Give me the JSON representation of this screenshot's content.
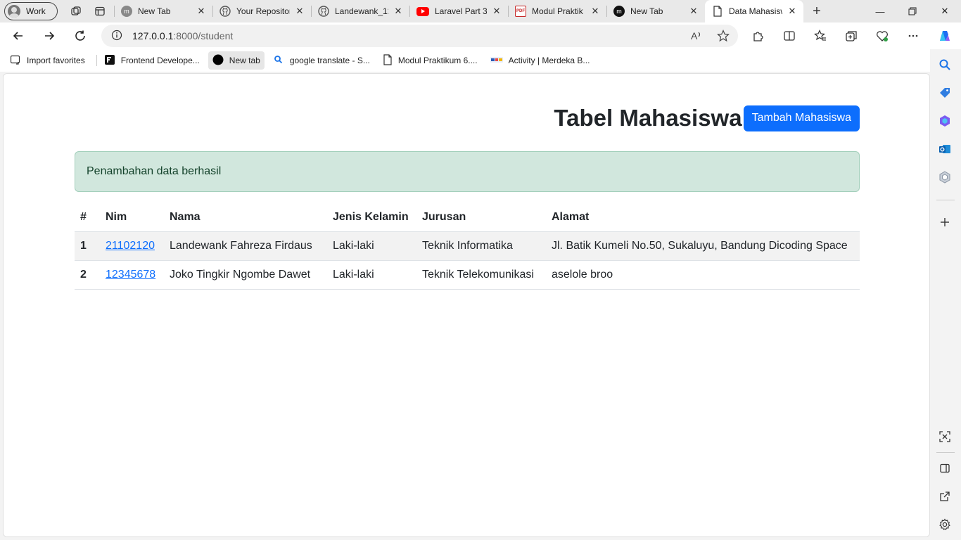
{
  "browser": {
    "profile_label": "Work",
    "tabs": [
      {
        "title": "New Tab",
        "favicon": "m-circle",
        "color": "#777777"
      },
      {
        "title": "Your Repositor",
        "favicon": "github-icon",
        "color": "#444444"
      },
      {
        "title": "Landewank_12",
        "favicon": "github-icon",
        "color": "#444444"
      },
      {
        "title": "Laravel Part 3",
        "favicon": "youtube-icon",
        "color": "#ff0000"
      },
      {
        "title": "Modul Praktik",
        "favicon": "pdf-icon",
        "color": "#c62828"
      },
      {
        "title": "New Tab",
        "favicon": "m-circle",
        "color": "#111111"
      },
      {
        "title": "Data Mahasisw",
        "favicon": "page-icon",
        "color": "#ffffff"
      }
    ],
    "address": {
      "host": "127.0.0.1",
      "rest": ":8000/student"
    },
    "favorites": [
      {
        "label": "Import favorites",
        "icon": "import-icon"
      },
      {
        "label": "Frontend Develope...",
        "icon": "fm-logo-icon"
      },
      {
        "label": "New tab",
        "icon": "black-circle-icon"
      },
      {
        "label": "google translate - S...",
        "icon": "search-icon"
      },
      {
        "label": "Modul Praktikum 6....",
        "icon": "page-icon"
      },
      {
        "label": "Activity | Merdeka B...",
        "icon": "kampus-merdeka-icon"
      }
    ]
  },
  "page": {
    "title": "Tabel Mahasiswa",
    "add_button": "Tambah Mahasiswa",
    "alert": "Penambahan data berhasil",
    "columns": [
      "#",
      "Nim",
      "Nama",
      "Jenis Kelamin",
      "Jurusan",
      "Alamat"
    ],
    "rows": [
      {
        "no": "1",
        "nim": "21102120",
        "nama": "Landewank Fahreza Firdaus",
        "jk": "Laki-laki",
        "jurusan": "Teknik Informatika",
        "alamat": "Jl. Batik Kumeli No.50, Sukaluyu, Bandung Dicoding Space"
      },
      {
        "no": "2",
        "nim": "12345678",
        "nama": "Joko Tingkir Ngombe Dawet",
        "jk": "Laki-laki",
        "jurusan": "Teknik Telekomunikasi",
        "alamat": "aselole broo"
      }
    ]
  },
  "colors": {
    "primary": "#0d6efd",
    "alert_bg": "#d1e7dd",
    "alert_border": "#a3cfbb"
  }
}
